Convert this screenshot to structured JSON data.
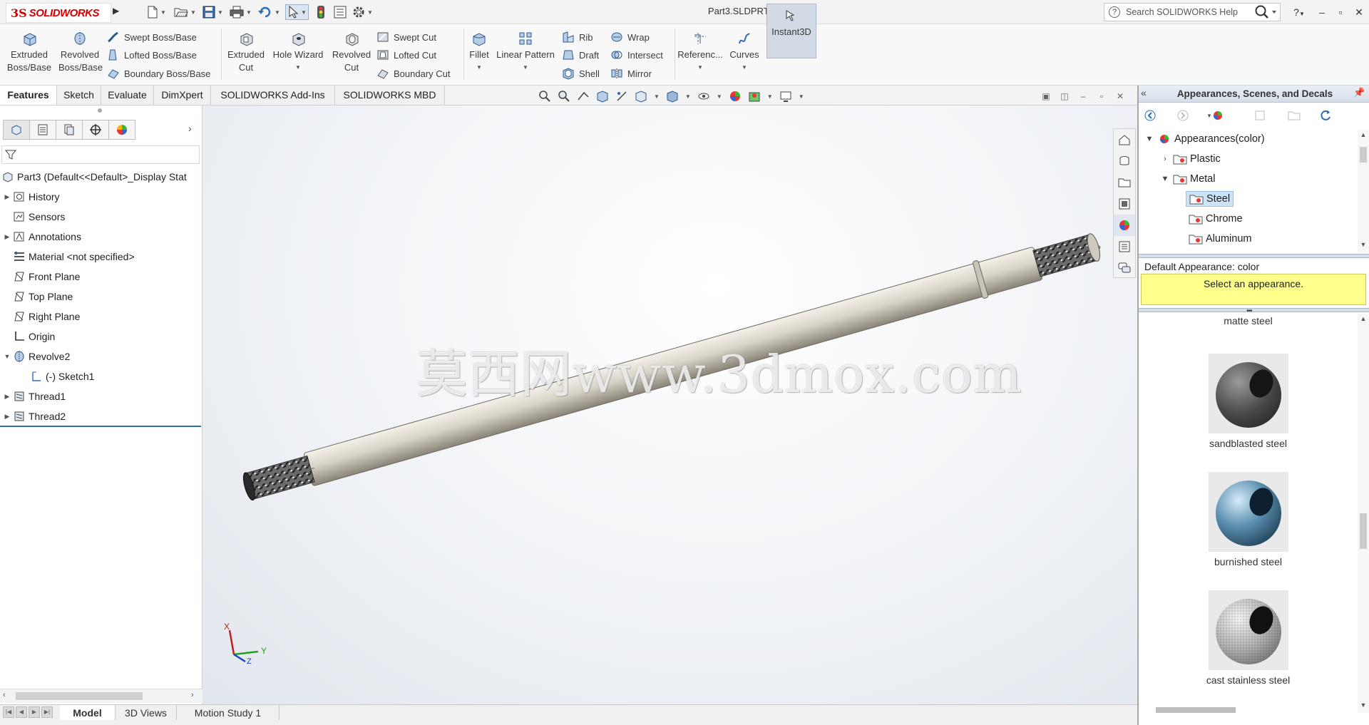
{
  "app": {
    "logo_prefix": "3S",
    "logo_text": "SOLIDWORKS",
    "document_title": "Part3.SLDPRT *",
    "search_placeholder": "Search SOLIDWORKS Help"
  },
  "window_controls": {
    "help": "?",
    "minimize": "–",
    "restore": "▫",
    "close": "✕"
  },
  "command_manager": {
    "extruded_boss": "Extruded Boss/Base",
    "revolved_boss": "Revolved Boss/Base",
    "swept_boss": "Swept Boss/Base",
    "lofted_boss": "Lofted Boss/Base",
    "boundary_boss": "Boundary Boss/Base",
    "extruded_cut": "Extruded Cut",
    "hole_wizard": "Hole Wizard",
    "revolved_cut": "Revolved Cut",
    "swept_cut": "Swept Cut",
    "lofted_cut": "Lofted Cut",
    "boundary_cut": "Boundary Cut",
    "fillet": "Fillet",
    "linear_pattern": "Linear Pattern",
    "rib": "Rib",
    "draft": "Draft",
    "shell": "Shell",
    "wrap": "Wrap",
    "intersect": "Intersect",
    "mirror": "Mirror",
    "reference": "Referenc...",
    "curves": "Curves",
    "instant3d": "Instant3D"
  },
  "tabs": [
    "Features",
    "Sketch",
    "Evaluate",
    "DimXpert",
    "SOLIDWORKS Add-Ins",
    "SOLIDWORKS MBD"
  ],
  "tree": {
    "root": "Part3  (Default<<Default>_Display Stat",
    "items": [
      {
        "label": "History"
      },
      {
        "label": "Sensors"
      },
      {
        "label": "Annotations"
      },
      {
        "label": "Material <not specified>"
      },
      {
        "label": "Front Plane"
      },
      {
        "label": "Top Plane"
      },
      {
        "label": "Right Plane"
      },
      {
        "label": "Origin"
      },
      {
        "label": "Revolve2"
      },
      {
        "label": "(-) Sketch1"
      },
      {
        "label": "Thread1"
      },
      {
        "label": "Thread2"
      }
    ]
  },
  "viewport": {
    "watermark": "莫西网www.3dmox.com",
    "triad_x": "X",
    "triad_y": "Y",
    "triad_z": "Z"
  },
  "bottom_tabs": [
    "Model",
    "3D Views",
    "Motion Study 1"
  ],
  "right_panel": {
    "title": "Appearances, Scenes, and Decals",
    "tree": {
      "root": "Appearances(color)",
      "plastic": "Plastic",
      "metal": "Metal",
      "steel": "Steel",
      "chrome": "Chrome",
      "aluminum": "Aluminum"
    },
    "default_appearance": "Default Appearance: color",
    "hint": "Select an appearance.",
    "gallery": [
      {
        "label": "matte steel"
      },
      {
        "label": "sandblasted steel"
      },
      {
        "label": "burnished steel"
      },
      {
        "label": "cast stainless steel"
      }
    ]
  },
  "colors": {
    "accent_blue": "#2d6db5",
    "brand_red": "#d40000",
    "hint_yellow": "#ffff8c",
    "shaft": "#d9d5cc"
  }
}
